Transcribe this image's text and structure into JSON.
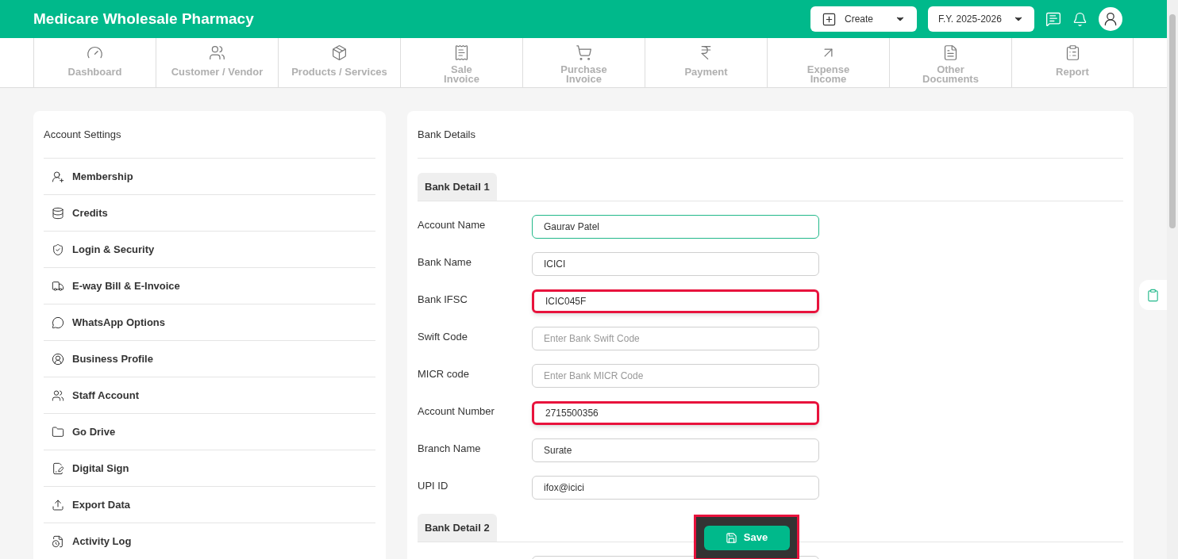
{
  "header": {
    "title": "Medicare Wholesale Pharmacy",
    "create_button": "Create",
    "year_select": "F.Y. 2025-2026"
  },
  "nav": [
    {
      "lines": [
        "Dashboard"
      ]
    },
    {
      "lines": [
        "Customer / Vendor"
      ]
    },
    {
      "lines": [
        "Products / Services"
      ]
    },
    {
      "lines": [
        "Sale",
        "Invoice"
      ]
    },
    {
      "lines": [
        "Purchase",
        "Invoice"
      ]
    },
    {
      "lines": [
        "Payment"
      ]
    },
    {
      "lines": [
        "Expense",
        "Income"
      ]
    },
    {
      "lines": [
        "Other",
        "Documents"
      ]
    },
    {
      "lines": [
        "Report"
      ]
    }
  ],
  "sidebar": {
    "title": "Account Settings",
    "items": [
      "Membership",
      "Credits",
      "Login & Security",
      "E-way Bill & E-Invoice",
      "WhatsApp Options",
      "Business Profile",
      "Staff Account",
      "Go Drive",
      "Digital Sign",
      "Export Data",
      "Activity Log"
    ]
  },
  "bank": {
    "title": "Bank Details",
    "sections": [
      {
        "tab": "Bank Detail 1",
        "fields": [
          {
            "label": "Account Name",
            "value": "Gaurav Patel",
            "focused": true,
            "highlighted": false
          },
          {
            "label": "Bank Name",
            "value": "ICICI",
            "focused": false,
            "highlighted": false
          },
          {
            "label": "Bank IFSC",
            "value": "ICIC045F",
            "focused": false,
            "highlighted": true
          },
          {
            "label": "Swift Code",
            "placeholder": "Enter Bank Swift Code",
            "focused": false,
            "highlighted": false
          },
          {
            "label": "MICR code",
            "placeholder": "Enter Bank MICR Code",
            "focused": false,
            "highlighted": false
          },
          {
            "label": "Account Number",
            "value": "2715500356",
            "focused": false,
            "highlighted": true
          },
          {
            "label": "Branch Name",
            "value": "Surate",
            "focused": false,
            "highlighted": false
          },
          {
            "label": "UPI ID",
            "value": "ifox@icici",
            "focused": false,
            "highlighted": false
          }
        ]
      },
      {
        "tab": "Bank Detail 2",
        "fields": [
          {
            "focused": false,
            "highlighted": false
          }
        ]
      }
    ]
  },
  "save_button": {
    "label": "Save",
    "highlighted": true
  }
}
